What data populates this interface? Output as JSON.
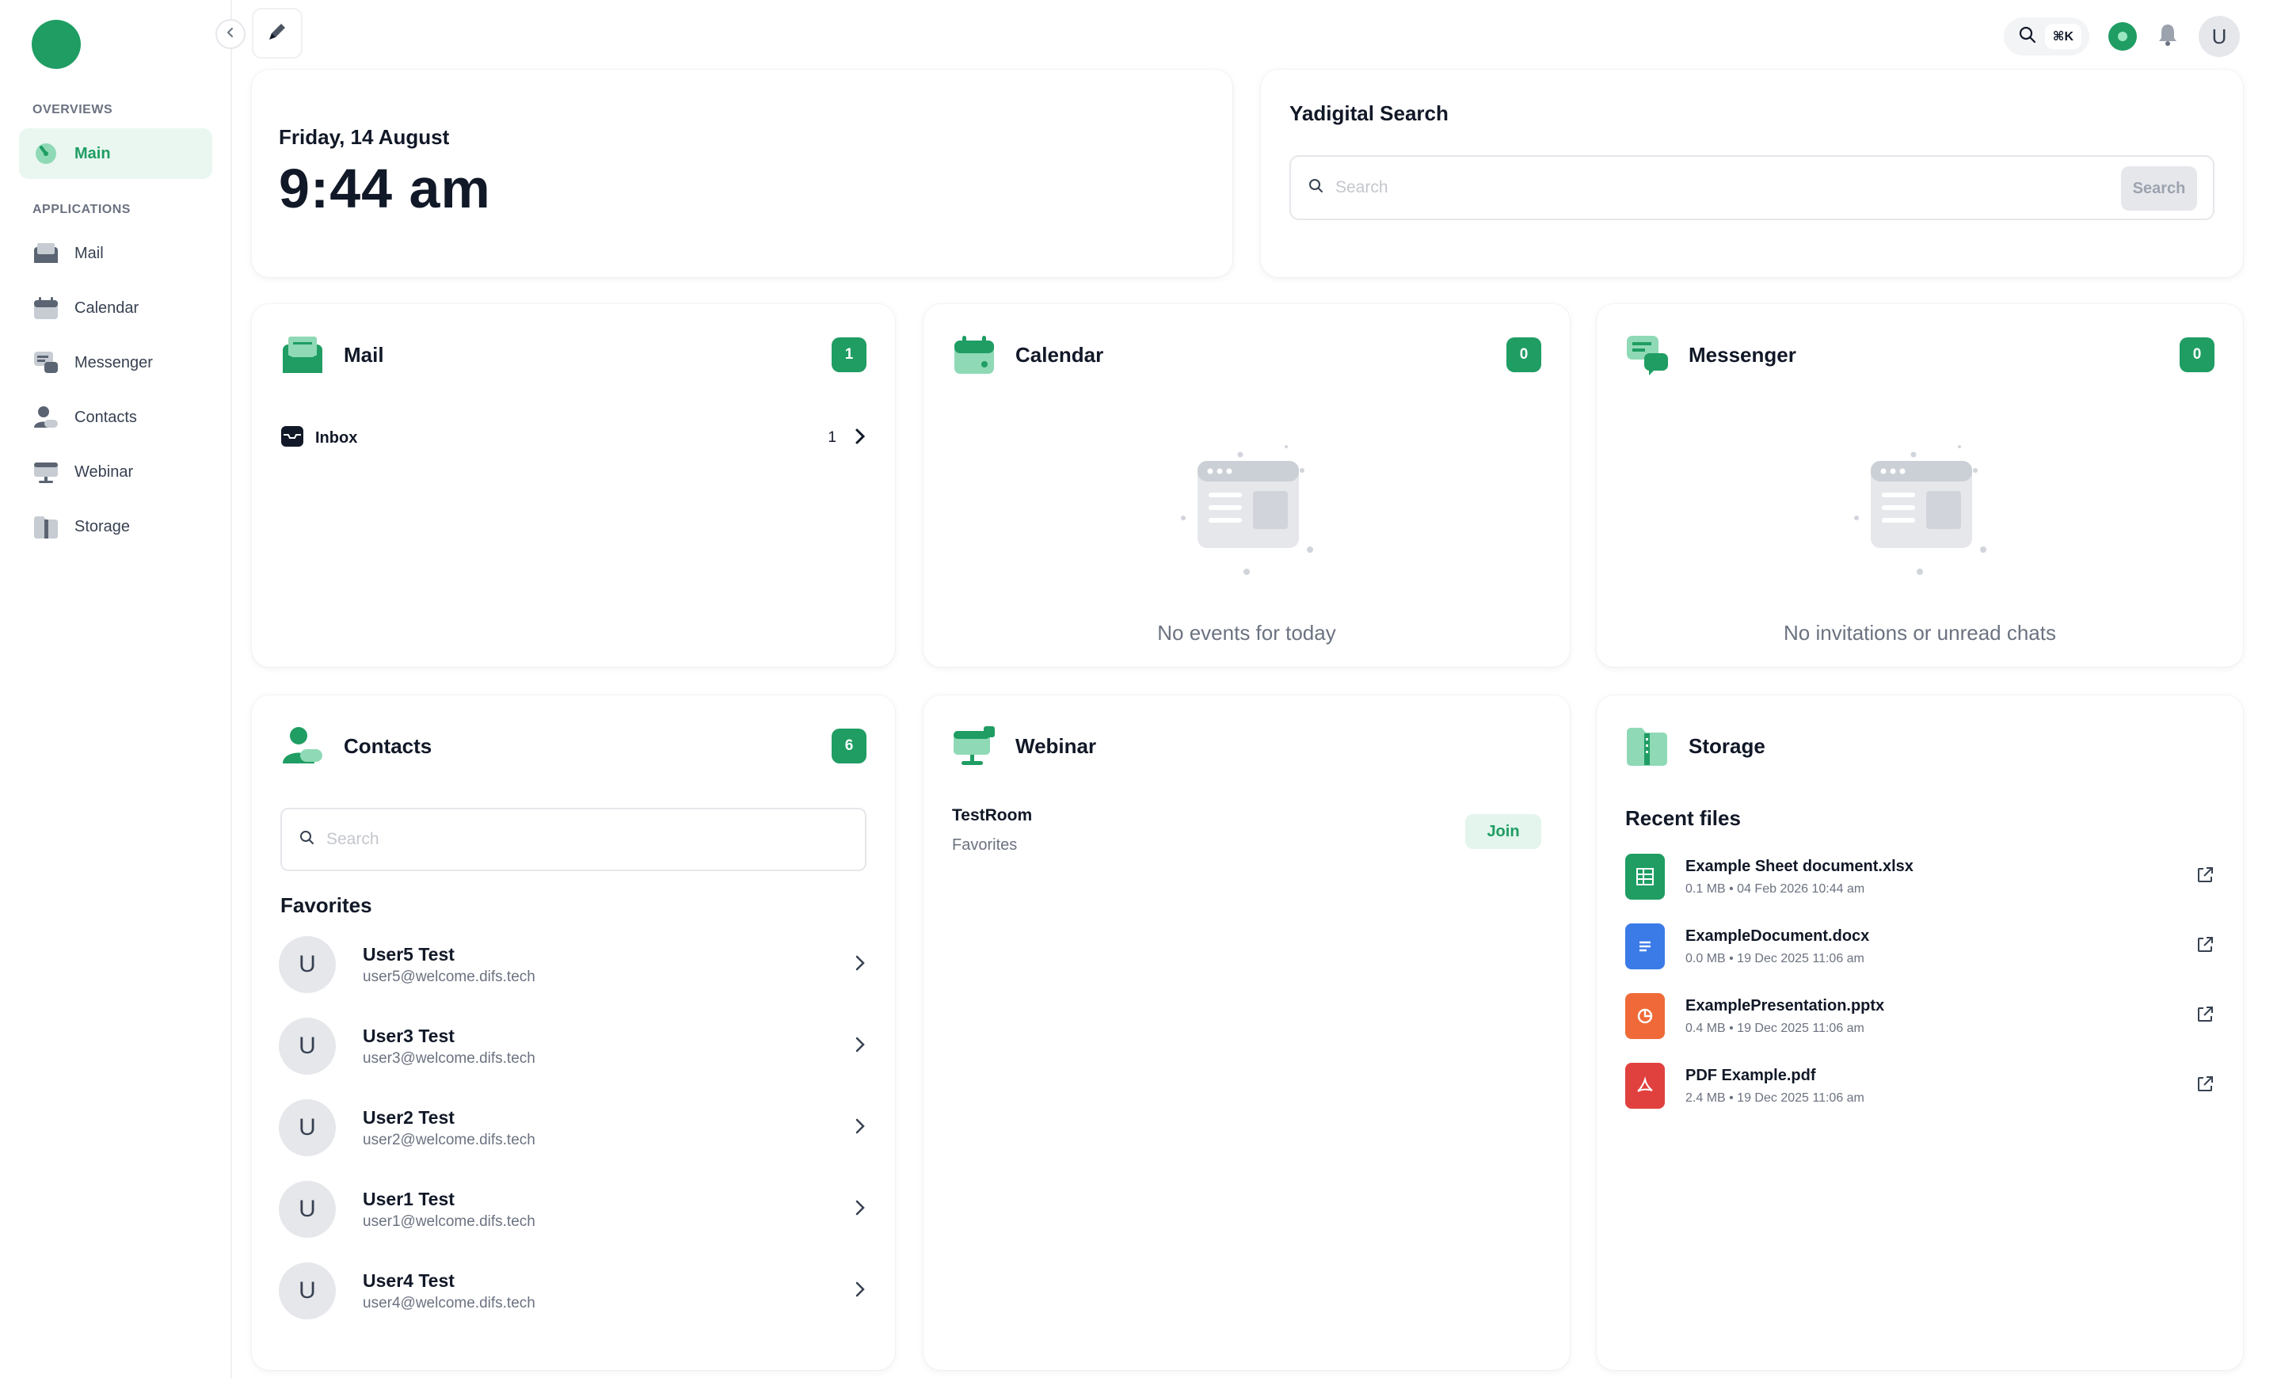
{
  "colors": {
    "accent": "#1f9d63",
    "accent_light": "#e9f7f0",
    "sheet": "#1f9d63",
    "doc": "#3b7be8",
    "slide": "#ef6a38",
    "pdf": "#e0413f"
  },
  "sidebar": {
    "sections": [
      {
        "label": "OVERVIEWS"
      },
      {
        "label": "APPLICATIONS"
      }
    ],
    "items": [
      {
        "label": "Main",
        "icon": "dashboard-gauge-icon",
        "active": true
      },
      {
        "label": "Mail",
        "icon": "mail-icon"
      },
      {
        "label": "Calendar",
        "icon": "calendar-icon"
      },
      {
        "label": "Messenger",
        "icon": "messenger-icon"
      },
      {
        "label": "Contacts",
        "icon": "contacts-icon"
      },
      {
        "label": "Webinar",
        "icon": "webinar-icon"
      },
      {
        "label": "Storage",
        "icon": "storage-icon"
      }
    ]
  },
  "topbar": {
    "shortcut": "⌘K",
    "avatar_letter": "U"
  },
  "clock": {
    "date": "Friday, 14 August",
    "time": "9:44 am"
  },
  "search_card": {
    "title": "Yadigital Search",
    "placeholder": "Search",
    "button": "Search"
  },
  "mail": {
    "title": "Mail",
    "badge": "1",
    "inbox_label": "Inbox",
    "inbox_count": "1"
  },
  "calendar": {
    "title": "Calendar",
    "badge": "0",
    "empty_text": "No events for today"
  },
  "messenger": {
    "title": "Messenger",
    "badge": "0",
    "empty_text": "No invitations or unread chats"
  },
  "contacts": {
    "title": "Contacts",
    "badge": "6",
    "search_placeholder": "Search",
    "favorites_label": "Favorites",
    "favorites": [
      {
        "initial": "U",
        "name": "User5 Test",
        "email": "user5@welcome.difs.tech"
      },
      {
        "initial": "U",
        "name": "User3 Test",
        "email": "user3@welcome.difs.tech"
      },
      {
        "initial": "U",
        "name": "User2 Test",
        "email": "user2@welcome.difs.tech"
      },
      {
        "initial": "U",
        "name": "User1 Test",
        "email": "user1@welcome.difs.tech"
      },
      {
        "initial": "U",
        "name": "User4 Test",
        "email": "user4@welcome.difs.tech"
      }
    ]
  },
  "webinar": {
    "title": "Webinar",
    "room_name": "TestRoom",
    "room_sub": "Favorites",
    "join_label": "Join"
  },
  "storage": {
    "title": "Storage",
    "recent_label": "Recent files",
    "files": [
      {
        "name": "Example Sheet document.xlsx",
        "meta": "0.1 MB  •  04 Feb 2026 10:44 am",
        "icon": "spreadsheet-file-icon"
      },
      {
        "name": "ExampleDocument.docx",
        "meta": "0.0 MB  •  19 Dec 2025 11:06 am",
        "icon": "document-file-icon"
      },
      {
        "name": "ExamplePresentation.pptx",
        "meta": "0.4 MB  •  19 Dec 2025 11:06 am",
        "icon": "presentation-file-icon"
      },
      {
        "name": "PDF Example.pdf",
        "meta": "2.4 MB  •  19 Dec 2025 11:06 am",
        "icon": "pdf-file-icon"
      }
    ]
  }
}
